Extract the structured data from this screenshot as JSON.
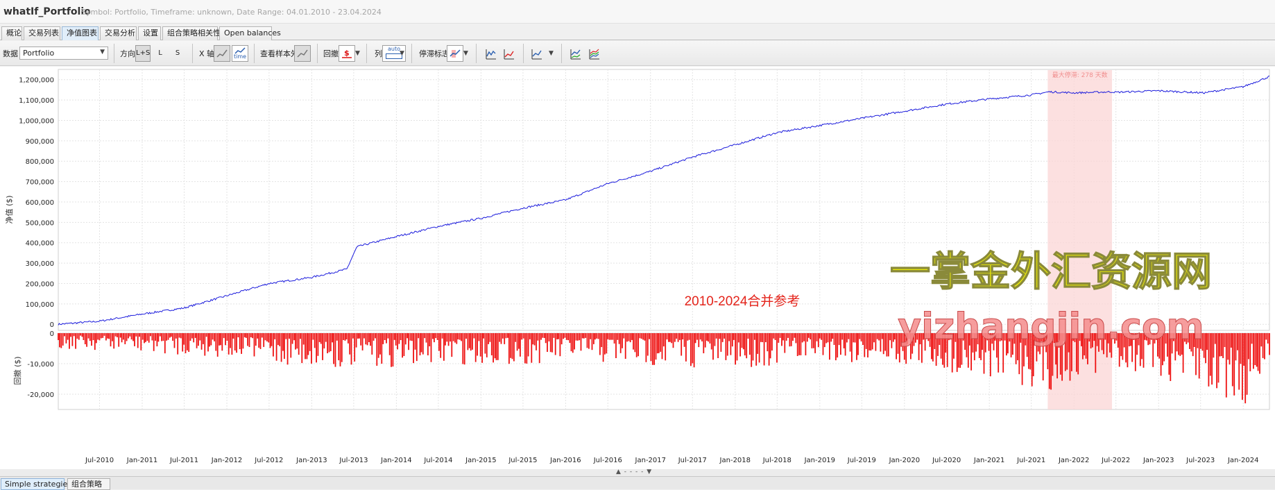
{
  "window": {
    "title": "whatIf_Portfolio",
    "subtitle": "Symbol: Portfolio, Timeframe: unknown, Date Range: 04.01.2010 - 23.04.2024"
  },
  "tabs": [
    {
      "label": "概论"
    },
    {
      "label": "交易列表"
    },
    {
      "label": "净值图表",
      "active": true
    },
    {
      "label": "交易分析"
    },
    {
      "label": "设置"
    },
    {
      "label": "组合策略相关性"
    },
    {
      "label": "Open balances"
    }
  ],
  "toolbar": {
    "data_label": "数据",
    "data_value": "Portfolio",
    "direction_label": "方向",
    "dir_ls": "L+S",
    "dir_l": "L",
    "dir_s": "S",
    "xaxis_label": "X 轴",
    "xaxis_time": "time",
    "oos_label": "查看样本外",
    "drawdown_label": "回撤",
    "columns_label": "列",
    "columns_auto": "auto",
    "stagnation_label": "停滞标志"
  },
  "chart_data": [
    {
      "type": "line",
      "ylabel": "净值 ($)",
      "x_range": [
        "2010-01-04",
        "2024-04-23"
      ],
      "ylim": [
        -30000,
        1250000
      ],
      "yticks": [
        "1,200,000",
        "1,100,000",
        "1,000,000",
        "900,000",
        "800,000",
        "700,000",
        "600,000",
        "500,000",
        "400,000",
        "300,000",
        "200,000",
        "100,000",
        "0"
      ],
      "grid": true,
      "series_color": "#1a1adc",
      "x": [
        "2010-01-04",
        "2010-07-01",
        "2011-01-01",
        "2011-07-01",
        "2012-01-01",
        "2012-07-01",
        "2013-01-01",
        "2013-06-01",
        "2013-07-15",
        "2014-01-01",
        "2014-07-01",
        "2015-01-01",
        "2015-07-01",
        "2016-01-01",
        "2016-07-01",
        "2017-01-01",
        "2017-07-01",
        "2018-01-01",
        "2018-07-01",
        "2019-01-01",
        "2019-07-01",
        "2020-01-01",
        "2020-07-01",
        "2021-01-01",
        "2021-07-01",
        "2021-09-15",
        "2022-01-01",
        "2022-06-14",
        "2022-07-01",
        "2023-01-01",
        "2023-07-15",
        "2024-01-01",
        "2024-04-23"
      ],
      "values": [
        0,
        15000,
        50000,
        80000,
        140000,
        200000,
        230000,
        270000,
        380000,
        430000,
        480000,
        520000,
        570000,
        610000,
        690000,
        750000,
        820000,
        880000,
        940000,
        975000,
        1010000,
        1045000,
        1080000,
        1105000,
        1125000,
        1140000,
        1135000,
        1140000,
        1138000,
        1145000,
        1135000,
        1165000,
        1215000
      ],
      "annotation_text": "2010-2024合并参考",
      "stagnation": {
        "label": "最大停滞: 278 天数",
        "start": "2021-09-10",
        "end": "2022-06-14",
        "color": "#fbd6d6"
      }
    },
    {
      "type": "area",
      "ylabel": "回撤 ($)",
      "ylim": [
        -25000,
        0
      ],
      "yticks": [
        "0",
        "-10,000",
        "-20,000"
      ],
      "grid": true,
      "series_color": "#ee1111",
      "x_ticks": [
        "Jul-2010",
        "Jan-2011",
        "Jul-2011",
        "Jan-2012",
        "Jul-2012",
        "Jan-2013",
        "Jul-2013",
        "Jan-2014",
        "Jul-2014",
        "Jan-2015",
        "Jul-2015",
        "Jan-2016",
        "Jul-2016",
        "Jan-2017",
        "Jul-2017",
        "Jan-2018",
        "Jul-2018",
        "Jan-2019",
        "Jul-2019",
        "Jan-2020",
        "Jul-2020",
        "Jan-2021",
        "Jul-2021",
        "Jan-2022",
        "Jul-2022",
        "Jan-2023",
        "Jul-2023",
        "Jan-2024"
      ],
      "x": [
        "2010-01-01",
        "2012-01-01",
        "2013-01-01",
        "2014-01-01",
        "2016-01-01",
        "2018-01-01",
        "2019-01-01",
        "2020-01-01",
        "2021-01-01",
        "2021-10-01",
        "2022-06-01",
        "2023-01-01",
        "2023-09-01",
        "2024-02-01",
        "2024-04-23"
      ],
      "values": [
        -5000,
        -8000,
        -12000,
        -11000,
        -10000,
        -12000,
        -9000,
        -11000,
        -15000,
        -19000,
        -12000,
        -15000,
        -23000,
        -24000,
        -12000
      ]
    }
  ],
  "watermark": {
    "line1": "一掌金外汇资源网",
    "line2": "yizhangjin.com"
  },
  "bottom_tabs": [
    {
      "label": "Simple strategies",
      "active": true
    },
    {
      "label": "组合策略"
    }
  ]
}
